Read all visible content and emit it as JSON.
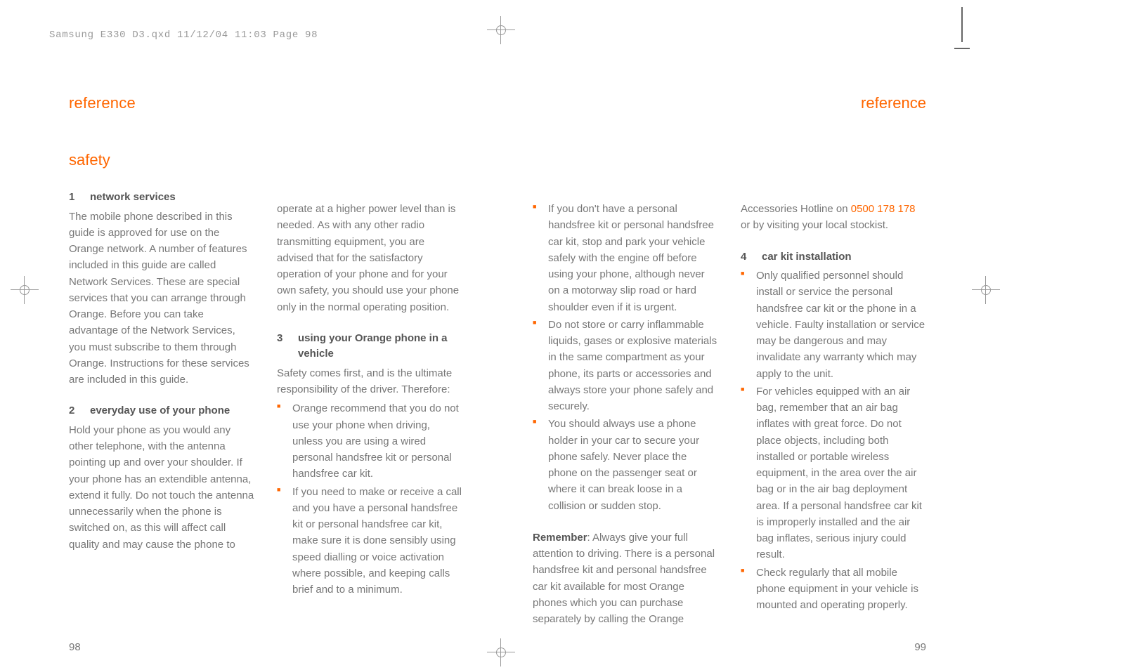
{
  "header": {
    "file_info": "Samsung E330 D3.qxd  11/12/04  11:03  Page 98"
  },
  "left": {
    "section_title": "reference",
    "safety_heading": "safety",
    "sub1": {
      "num": "1",
      "title": "network services",
      "body": "The mobile phone described in this guide is approved for use on the Orange network. A number of features included in this guide are called Network Services. These are special services that you can arrange through Orange. Before you can take advantage of the Network Services, you must subscribe to them through Orange. Instructions for these services are included in this guide."
    },
    "sub2": {
      "num": "2",
      "title": "everyday use of your phone",
      "body": "Hold your phone as you would any other telephone, with the antenna pointing up and over your shoulder. If your phone has an extendible antenna, extend it fully. Do not touch the antenna unnecessarily when the phone is switched on, as this will affect call quality and may cause the phone to"
    },
    "col2_cont": "operate at a higher power level than is needed. As with any other radio transmitting equipment, you are advised that for the satisfactory operation of your phone and for your own safety, you should use your phone only in the normal operating position.",
    "sub3": {
      "num": "3",
      "title": "using your Orange phone in a vehicle",
      "intro": "Safety comes first, and is the ultimate responsibility of the driver. Therefore:",
      "bullets": [
        "Orange recommend that you do not use your phone when driving, unless you are using a wired personal handsfree kit or personal handsfree car kit.",
        "If you need to make or receive a call and you have a personal handsfree kit or personal handsfree car kit, make sure it is done sensibly using speed dialling or voice activation where possible, and keeping calls brief and to a minimum."
      ]
    },
    "page_num": "98"
  },
  "right": {
    "section_title": "reference",
    "col1_bullets": [
      "If you don't have a personal handsfree kit or personal handsfree car kit, stop and park your vehicle safely with the engine off before using your phone, although never on a motorway slip road or hard shoulder even if it is urgent.",
      "Do not store or carry inflammable liquids, gases or explosive materials in the same compartment as your phone, its parts or accessories and always store your phone safely and securely.",
      "You should always use a phone holder in your car to secure your phone safely. Never place the phone on the passenger seat or where it can break loose in a collision or sudden stop."
    ],
    "remember_label": "Remember",
    "remember_text": ": Always give your full attention to driving. There is a personal handsfree kit and personal handsfree car kit available for most Orange phones which you can purchase separately by calling the Orange",
    "col2_cont_pre": "Accessories Hotline on ",
    "phone_number": "0500 178 178",
    "col2_cont_post": " or by visiting your local stockist.",
    "sub4": {
      "num": "4",
      "title": "car kit installation",
      "bullets": [
        "Only qualified personnel should install or service the personal handsfree car kit or the phone in a vehicle. Faulty installation or service may be dangerous and may invalidate any warranty which may apply to the unit.",
        "For vehicles equipped with an air bag, remember that an air bag inflates with great force. Do not place objects, including both installed or portable wireless equipment, in the area over the air bag or in the air bag deployment area. If a personal handsfree car kit is improperly installed and the air bag inflates, serious injury could result.",
        "Check regularly that all mobile phone equipment in your vehicle is mounted and operating properly."
      ]
    },
    "page_num": "99"
  }
}
